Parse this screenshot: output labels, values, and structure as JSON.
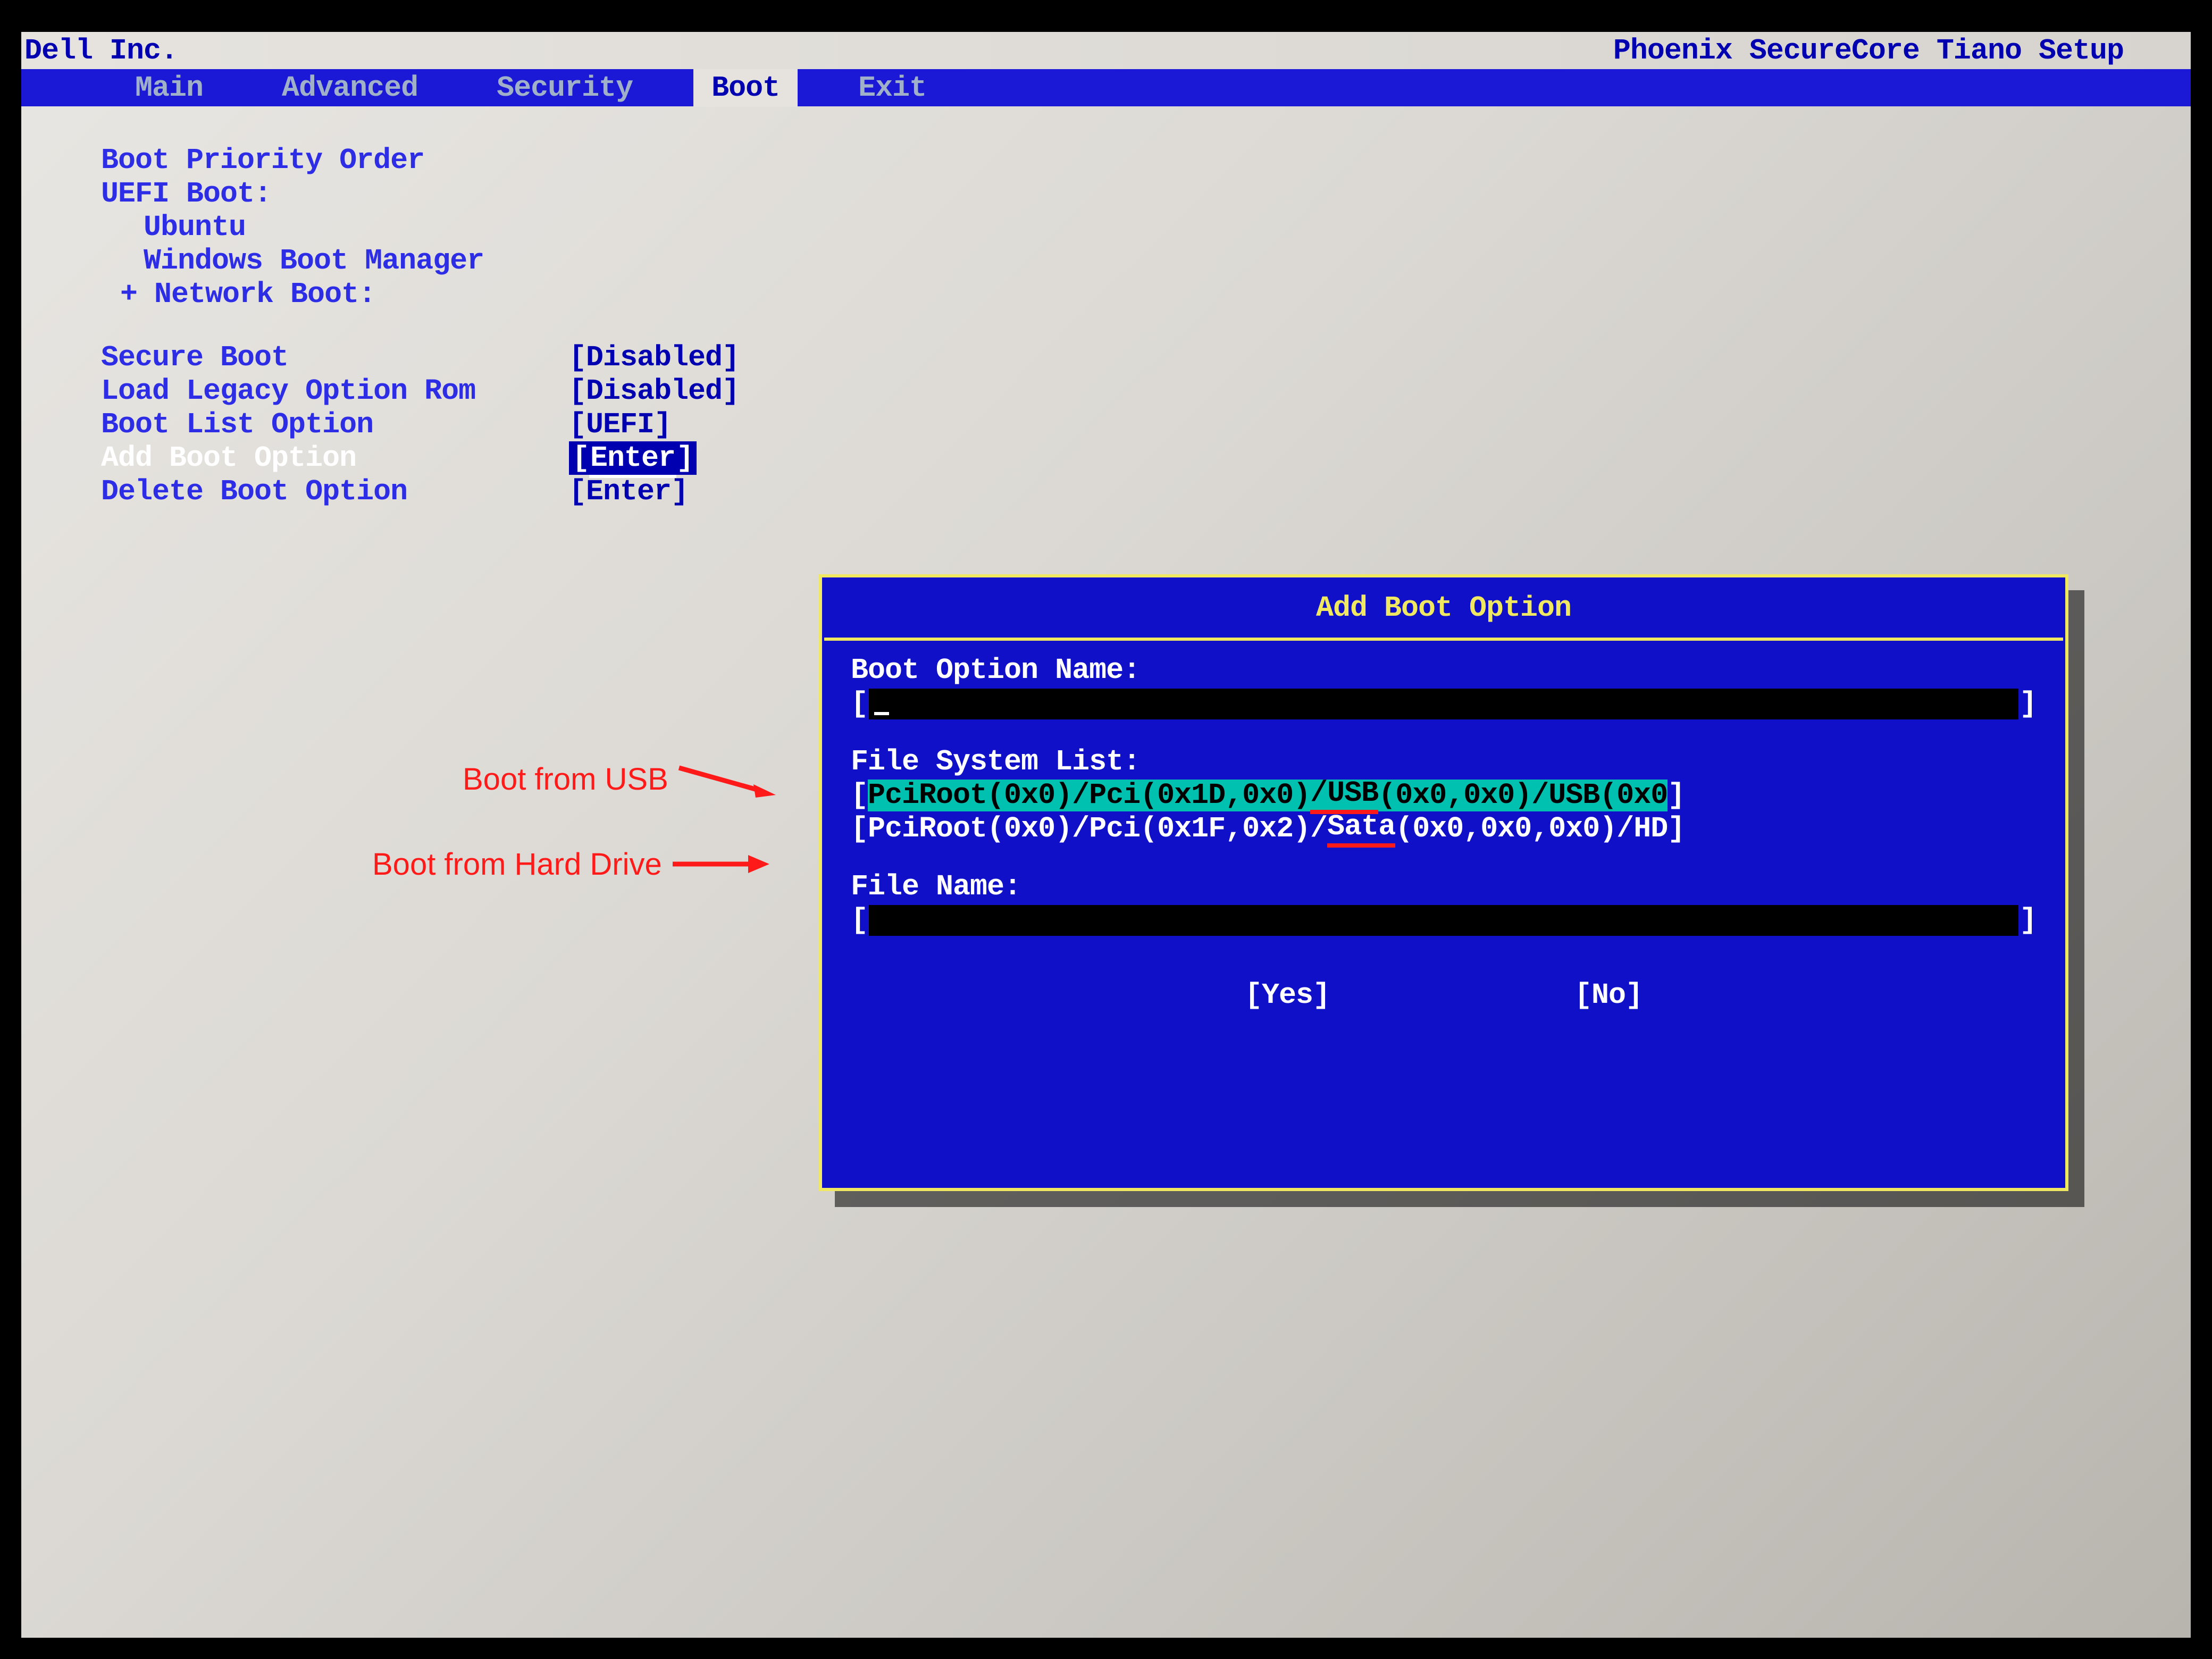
{
  "title": {
    "vendor": "Dell Inc.",
    "product": "Phoenix SecureCore Tiano Setup"
  },
  "menu": {
    "items": [
      "Main",
      "Advanced",
      "Security",
      "Boot",
      "Exit"
    ],
    "active_index": 3
  },
  "boot_page": {
    "heading": "Boot Priority Order",
    "uefi_label": "UEFI Boot:",
    "uefi_items": [
      "Ubuntu",
      "Windows Boot Manager"
    ],
    "network_label": "+ Network Boot:",
    "settings": [
      {
        "label": "Secure Boot",
        "value": "[Disabled]"
      },
      {
        "label": "Load Legacy Option Rom",
        "value": "[Disabled]"
      },
      {
        "label": "Boot List Option",
        "value": "[UEFI]"
      },
      {
        "label": "Add Boot Option",
        "value": "Enter",
        "highlighted": true
      },
      {
        "label": "Delete Boot Option",
        "value": "[Enter]"
      }
    ]
  },
  "dialog": {
    "title": "Add Boot Option",
    "name_label": "Boot Option Name:",
    "name_value": "",
    "fslist_label": "File System List:",
    "fs_items": [
      {
        "pre": "PciRoot(0x0)/Pci(0x1D,0x0)",
        "mark": "/USB",
        "post": "(0x0,0x0)/USB(0x0",
        "selected": true
      },
      {
        "pre": "PciRoot(0x0)/Pci(0x1F,0x2)/",
        "mark": "Sata",
        "post": "(0x0,0x0,0x0)/HD",
        "selected": false
      }
    ],
    "filename_label": "File Name:",
    "filename_value": "",
    "yes": "[Yes]",
    "no": "[No]"
  },
  "annotations": {
    "usb": "Boot from USB",
    "hdd": "Boot from Hard Drive"
  }
}
